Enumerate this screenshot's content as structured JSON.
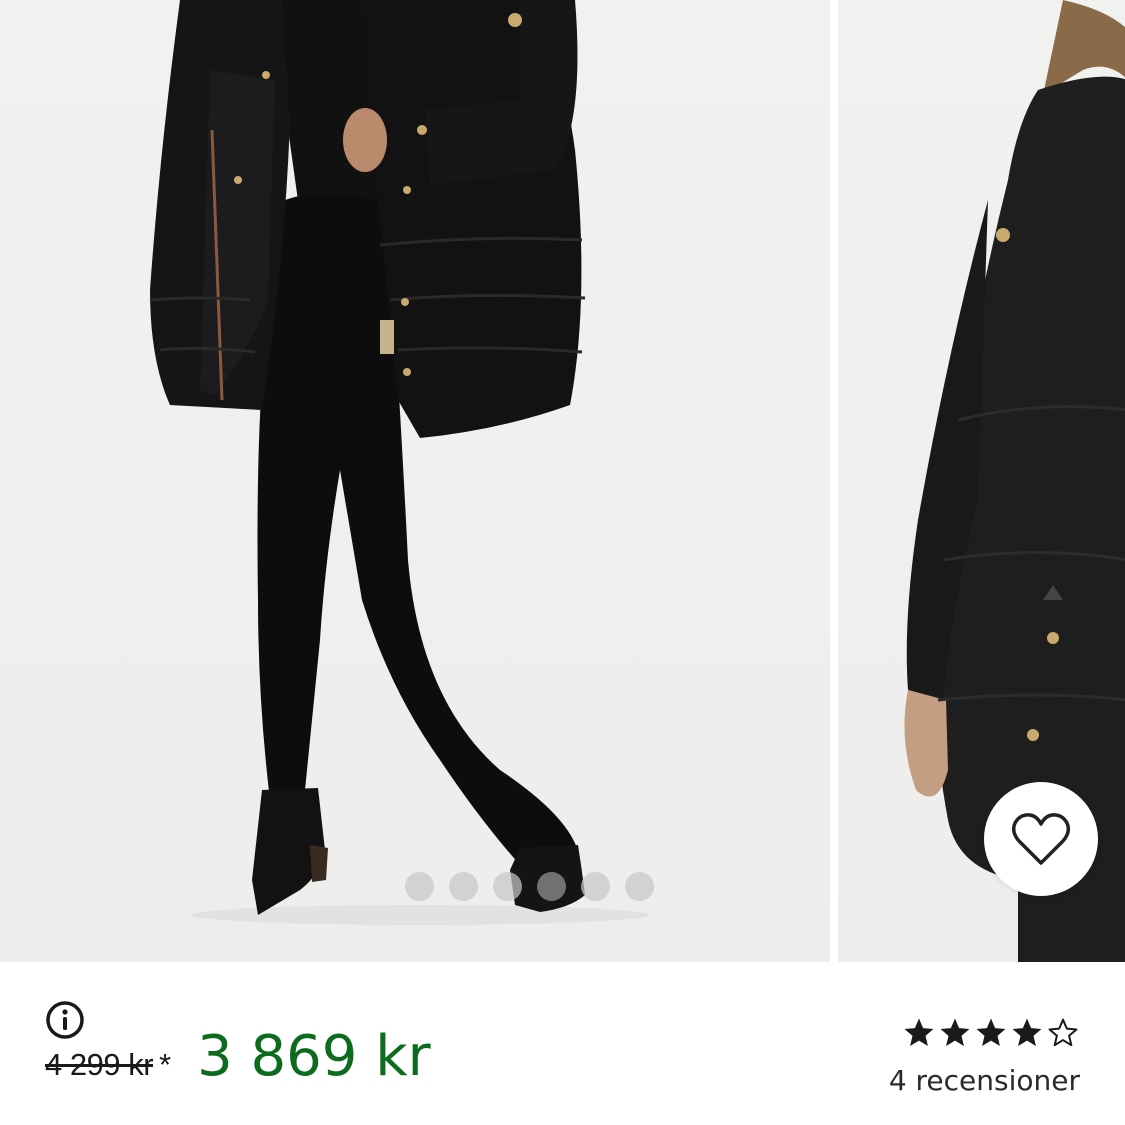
{
  "gallery": {
    "slide_count": 6,
    "active_index": 3,
    "main_image_alt": "Woman wearing black padded down parka with zip pockets, black flared trousers and black ankle boots",
    "next_image_alt": "Side view of black parka with faux fur hood"
  },
  "favorite": {
    "icon": "heart-outline-icon"
  },
  "product": {
    "info_icon": "info-circle-icon",
    "old_price": "4 299 kr",
    "asterisk": "*",
    "sale_price": "3 869 kr",
    "rating": {
      "value": 4,
      "max": 5
    },
    "review_count_text": "4 recensioner"
  },
  "colors": {
    "sale_price": "#0c6b1d",
    "text": "#1a1a1a",
    "background": "#ffffff",
    "image_background": "#efefee"
  }
}
